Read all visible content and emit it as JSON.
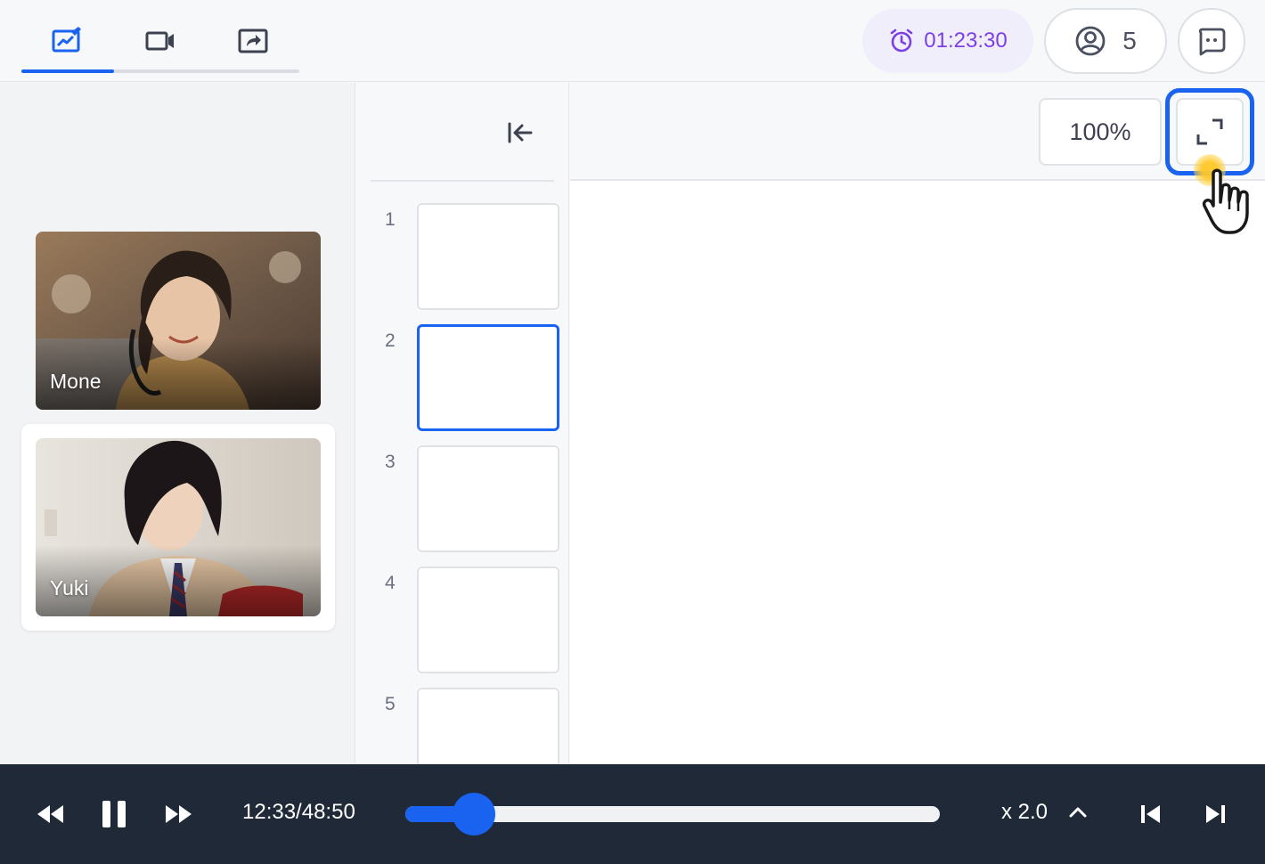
{
  "header": {
    "tabs": [
      {
        "icon": "whiteboard-icon",
        "active": true
      },
      {
        "icon": "video-camera-icon",
        "active": false
      },
      {
        "icon": "screen-share-icon",
        "active": false
      }
    ],
    "timer": {
      "icon": "alarm-clock-icon",
      "value": "01:23:30"
    },
    "participants": {
      "icon": "user-circle-icon",
      "count": "5"
    },
    "chat": {
      "icon": "chat-bubble-icon"
    }
  },
  "videos": [
    {
      "name": "Mone"
    },
    {
      "name": "Yuki"
    }
  ],
  "slides": {
    "numbers": [
      "1",
      "2",
      "3",
      "4",
      "5"
    ],
    "active_index": 2
  },
  "toolbar": {
    "zoom": "100%",
    "fullscreen_icon": "expand-icon"
  },
  "player": {
    "time": "12:33/48:50",
    "progress": 0.128,
    "speed": "x 2.0"
  },
  "colors": {
    "accent": "#1a62f0",
    "timer": "#7b3fe4",
    "player_bg": "#1f2937"
  }
}
